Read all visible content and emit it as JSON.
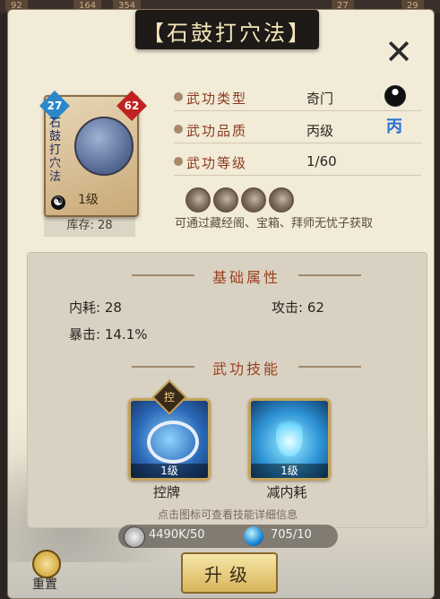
{
  "top_strip": {
    "items": [
      "92",
      "164",
      "354",
      "27",
      "29"
    ]
  },
  "title": "【石鼓打穴法】",
  "card": {
    "level_left": "27",
    "level_right": "62",
    "vertical_name": "石鼓打穴法",
    "level_text": "1级",
    "stock": "库存: 28"
  },
  "info": {
    "rows": [
      {
        "label": "武功类型",
        "value": "奇门",
        "icon": "taiji-icon"
      },
      {
        "label": "武功品质",
        "value": "丙级",
        "icon": "grade-bing-icon",
        "icon_text": "丙"
      },
      {
        "label": "武功等级",
        "value": "1/60",
        "icon": ""
      }
    ],
    "leaf_slots": 4,
    "obtain_text": "可通过藏经阁、宝箱、拜师无忧子获取"
  },
  "stats": {
    "header": "基础属性",
    "items": [
      {
        "label": "内耗:",
        "value": "28"
      },
      {
        "label": "攻击:",
        "value": "62"
      },
      {
        "label": "暴击:",
        "value": "14.1%"
      }
    ]
  },
  "skills": {
    "header": "武功技能",
    "badge_text": "控",
    "items": [
      {
        "name": "控牌",
        "level": "1级",
        "icon": "chain-icon"
      },
      {
        "name": "减内耗",
        "level": "1级",
        "icon": "blue-flame-icon"
      }
    ],
    "hint": "点击图标可查看技能详细信息"
  },
  "resources": {
    "silver": "4490K/50",
    "gem": "705/10"
  },
  "buttons": {
    "upgrade": "升级",
    "reset": "重置",
    "close": "✕"
  },
  "colors": {
    "panel": "#f1ebd8",
    "accent_red": "#8a3b1e",
    "title_bar": "#1e1a18",
    "gold": "#d9b45a"
  }
}
